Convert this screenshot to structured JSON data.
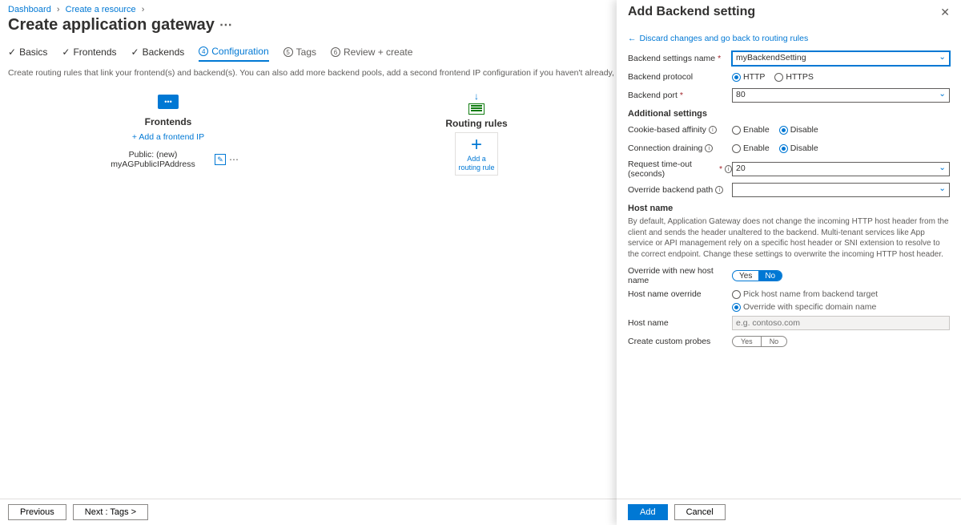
{
  "breadcrumb": {
    "items": [
      "Dashboard",
      "Create a resource"
    ]
  },
  "page_title": "Create application gateway",
  "tabs": {
    "basics": "Basics",
    "frontends": "Frontends",
    "backends": "Backends",
    "configuration": "Configuration",
    "tags": "Tags",
    "review": "Review + create"
  },
  "description": "Create routing rules that link your frontend(s) and backend(s). You can also add more backend pools, add a second frontend IP configuration if you haven't already, or edit previous configurations.",
  "frontends": {
    "heading": "Frontends",
    "add_link": "+ Add a frontend IP",
    "item_label": "Public: (new) myAGPublicIPAddress"
  },
  "routing": {
    "heading": "Routing rules",
    "add_label": "Add a routing rule"
  },
  "footer": {
    "previous": "Previous",
    "next": "Next : Tags >"
  },
  "panel": {
    "title": "Add Backend setting",
    "back": "Discard changes and go back to routing rules",
    "labels": {
      "name": "Backend settings name",
      "protocol": "Backend protocol",
      "port": "Backend port",
      "additional": "Additional settings",
      "affinity": "Cookie-based affinity",
      "draining": "Connection draining",
      "timeout": "Request time-out (seconds)",
      "override_path": "Override backend path",
      "host_name_h": "Host name",
      "override_host": "Override with new host name",
      "hostname_override": "Host name override",
      "hostname": "Host name",
      "probes": "Create custom probes"
    },
    "values": {
      "name": "myBackendSetting",
      "port": "80",
      "timeout": "20",
      "override_path": "",
      "hostname_placeholder": "e.g. contoso.com"
    },
    "options": {
      "http": "HTTP",
      "https": "HTTPS",
      "enable": "Enable",
      "disable": "Disable",
      "yes": "Yes",
      "no": "No",
      "pick_backend": "Pick host name from backend target",
      "override_domain": "Override with specific domain name"
    },
    "hostname_desc": "By default, Application Gateway does not change the incoming HTTP host header from the client and sends the header unaltered to the backend. Multi-tenant services like App service or API management rely on a specific host header or SNI extension to resolve to the correct endpoint. Change these settings to overwrite the incoming HTTP host header.",
    "footer": {
      "add": "Add",
      "cancel": "Cancel"
    }
  }
}
